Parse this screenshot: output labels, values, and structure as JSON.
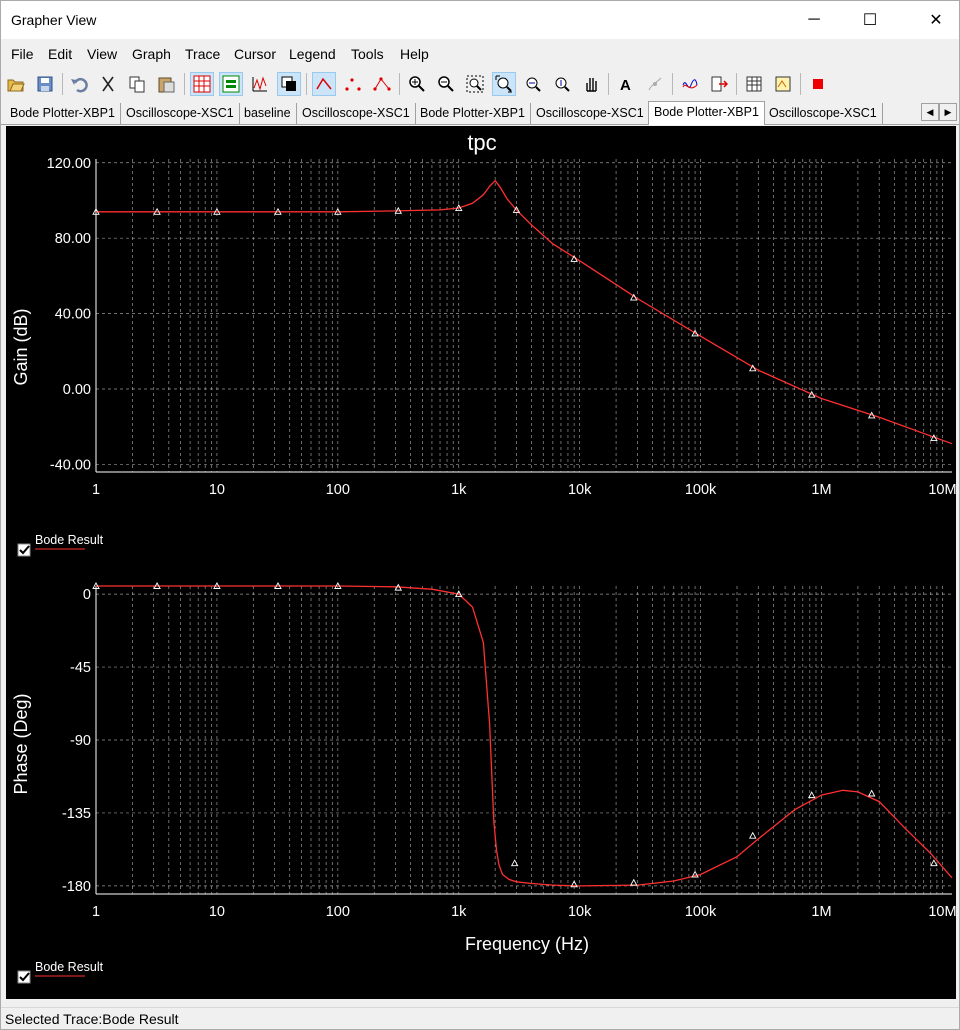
{
  "window": {
    "title": "Grapher View",
    "minimize": "─",
    "maximize": "☐",
    "close": "✕"
  },
  "menu": [
    "File",
    "Edit",
    "View",
    "Graph",
    "Trace",
    "Cursor",
    "Legend",
    "Tools",
    "Help"
  ],
  "toolbar": [
    "open-icon",
    "save-icon",
    "undo-icon",
    "cut-icon",
    "copy-icon",
    "paste-icon",
    "grid-icon",
    "legend-icon",
    "overlay-traces-icon",
    "reverse-colors-icon",
    "show-lines-icon",
    "show-points-icon",
    "show-lines-and-points-icon",
    "zoom-in-icon",
    "zoom-out-icon",
    "zoom-area-icon",
    "zoom-full-icon",
    "zoom-x-icon",
    "zoom-y-icon",
    "pan-icon",
    "text-icon",
    "cursor-annotation-icon",
    "bode-icon",
    "export-icon",
    "export-excel-icon",
    "export-lab-icon",
    "stop-icon"
  ],
  "tabs": [
    "Bode Plotter-XBP1",
    "Oscilloscope-XSC1",
    "baseline",
    "Oscilloscope-XSC1",
    "Bode Plotter-XBP1",
    "Oscilloscope-XSC1",
    "Bode Plotter-XBP1",
    "Oscilloscope-XSC1"
  ],
  "selected_tab": 6,
  "colors": {
    "trace": "#ff3030",
    "grid": "#cccccc",
    "background": "#000000"
  },
  "chart_data": [
    {
      "type": "line",
      "title": "tpc",
      "ylabel": "Gain (dB)",
      "xlabel": "",
      "xscale": "log",
      "xlim": [
        1,
        12000000
      ],
      "ylim": [
        -44,
        122
      ],
      "yticks": [
        120,
        80,
        40,
        0,
        -40
      ],
      "ytick_labels": [
        "120.00",
        "80.00",
        "40.00",
        "0.00",
        "-40.00"
      ],
      "xticks": [
        1,
        10,
        100,
        1000,
        10000,
        100000,
        1000000,
        10000000
      ],
      "xtick_labels": [
        "1",
        "10",
        "100",
        "1k",
        "10k",
        "100k",
        "1M",
        "10M"
      ],
      "legend": "Bode Result",
      "grid": true,
      "series": [
        {
          "name": "Bode Result",
          "x": [
            1,
            10,
            100,
            300,
            700,
            1000,
            1300,
            1600,
            1800,
            2000,
            2200,
            2500,
            3000,
            4000,
            6000,
            10000,
            30000,
            100000,
            300000,
            1000000,
            3000000,
            12000000
          ],
          "y": [
            94,
            94,
            94,
            94.5,
            95,
            96,
            98.5,
            103,
            107.5,
            110.5,
            107,
            101,
            95,
            87,
            77,
            68,
            48,
            28,
            10,
            -5,
            -15,
            -29
          ],
          "marker_x": [
            1,
            3.2,
            10,
            32,
            100,
            316,
            1000,
            3000,
            9000,
            28000,
            90000,
            270000,
            830000,
            2600000,
            8500000
          ],
          "marker_y": [
            94,
            94,
            94,
            94,
            94,
            94.5,
            96,
            95,
            69,
            48.5,
            29.5,
            11,
            -3,
            -14,
            -26
          ]
        }
      ]
    },
    {
      "type": "line",
      "xlabel": "Frequency (Hz)",
      "ylabel": "Phase (Deg)",
      "xscale": "log",
      "xlim": [
        1,
        12000000
      ],
      "ylim": [
        -185,
        5
      ],
      "yticks": [
        0,
        -45,
        -90,
        -135,
        -180
      ],
      "ytick_labels": [
        "0",
        "-45",
        "-90",
        "-135",
        "-180"
      ],
      "xticks": [
        1,
        10,
        100,
        1000,
        10000,
        100000,
        1000000,
        10000000
      ],
      "xtick_labels": [
        "1",
        "10",
        "100",
        "1k",
        "10k",
        "100k",
        "1M",
        "10M"
      ],
      "legend": "Bode Result",
      "grid": true,
      "series": [
        {
          "name": "Bode Result",
          "x": [
            1,
            10,
            100,
            300,
            600,
            1000,
            1300,
            1600,
            1800,
            1950,
            2050,
            2150,
            2300,
            2600,
            3000,
            4000,
            6000,
            10000,
            30000,
            60000,
            100000,
            200000,
            300000,
            600000,
            1000000,
            1500000,
            2000000,
            3000000,
            5000000,
            8000000,
            12000000
          ],
          "y": [
            5,
            5,
            5,
            4.5,
            3,
            0,
            -8,
            -30,
            -80,
            -140,
            -158,
            -167,
            -173,
            -176,
            -177.5,
            -178.5,
            -179.5,
            -180,
            -179.5,
            -177,
            -173,
            -162,
            -151,
            -133,
            -124,
            -121,
            -122,
            -128,
            -145,
            -160,
            -175
          ],
          "marker_x": [
            1,
            3.2,
            10,
            32,
            100,
            316,
            1000,
            2900,
            9000,
            28000,
            90000,
            270000,
            830000,
            2600000,
            8500000
          ],
          "marker_y": [
            5,
            5,
            5,
            5,
            5,
            4,
            0,
            -166,
            -179,
            -178,
            -173,
            -149,
            -124,
            -123,
            -166
          ]
        }
      ]
    }
  ],
  "status": "Selected Trace:Bode Result"
}
